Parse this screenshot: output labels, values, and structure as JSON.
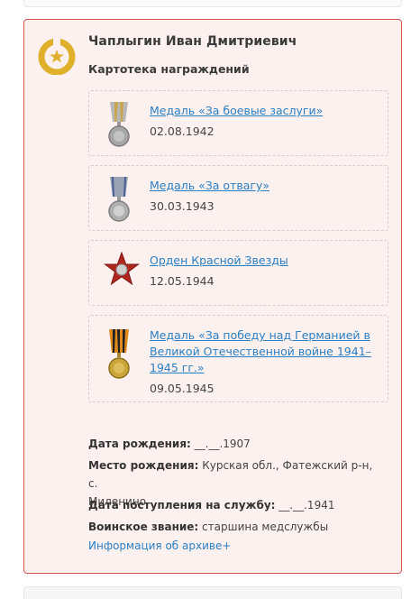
{
  "person": {
    "name": "Чаплыгин Иван Дмитриевич",
    "section_title": "Картотека награждений"
  },
  "awards": [
    {
      "name": "Медаль «За боевые заслуги»",
      "date": "02.08.1942",
      "icon": "medal-combat-merit-icon"
    },
    {
      "name": "Медаль «За отвагу»",
      "date": "30.03.1943",
      "icon": "medal-courage-icon"
    },
    {
      "name": "Орден Красной Звезды",
      "date": "12.05.1944",
      "icon": "order-red-star-icon"
    },
    {
      "name_lines": [
        "Медаль «За победу над Германией в",
        "Великой Отечественной войне 1941–",
        "1945 гг.»"
      ],
      "date": "09.05.1945",
      "icon": "medal-victory-germany-icon"
    }
  ],
  "details": {
    "birth_date_label": "Дата рождения:",
    "birth_date_value": " __.__.1907",
    "birth_place_label": "Место рождения:",
    "birth_place_value_1": " Курская обл., Фатежский р-н, с.",
    "birth_place_value_2": "Миленино",
    "service_label": "Дата поступления на службу:",
    "service_value": " __.__.1941",
    "rank_label": "Воинское звание:",
    "rank_value": " старшина медслужбы"
  },
  "archive_link": "Информация об архиве+",
  "colors": {
    "accent_link": "#2a7fc4",
    "card_border": "#d9534f",
    "card_bg": "#fdf1f0",
    "badge_gold": "#e0b02a"
  }
}
